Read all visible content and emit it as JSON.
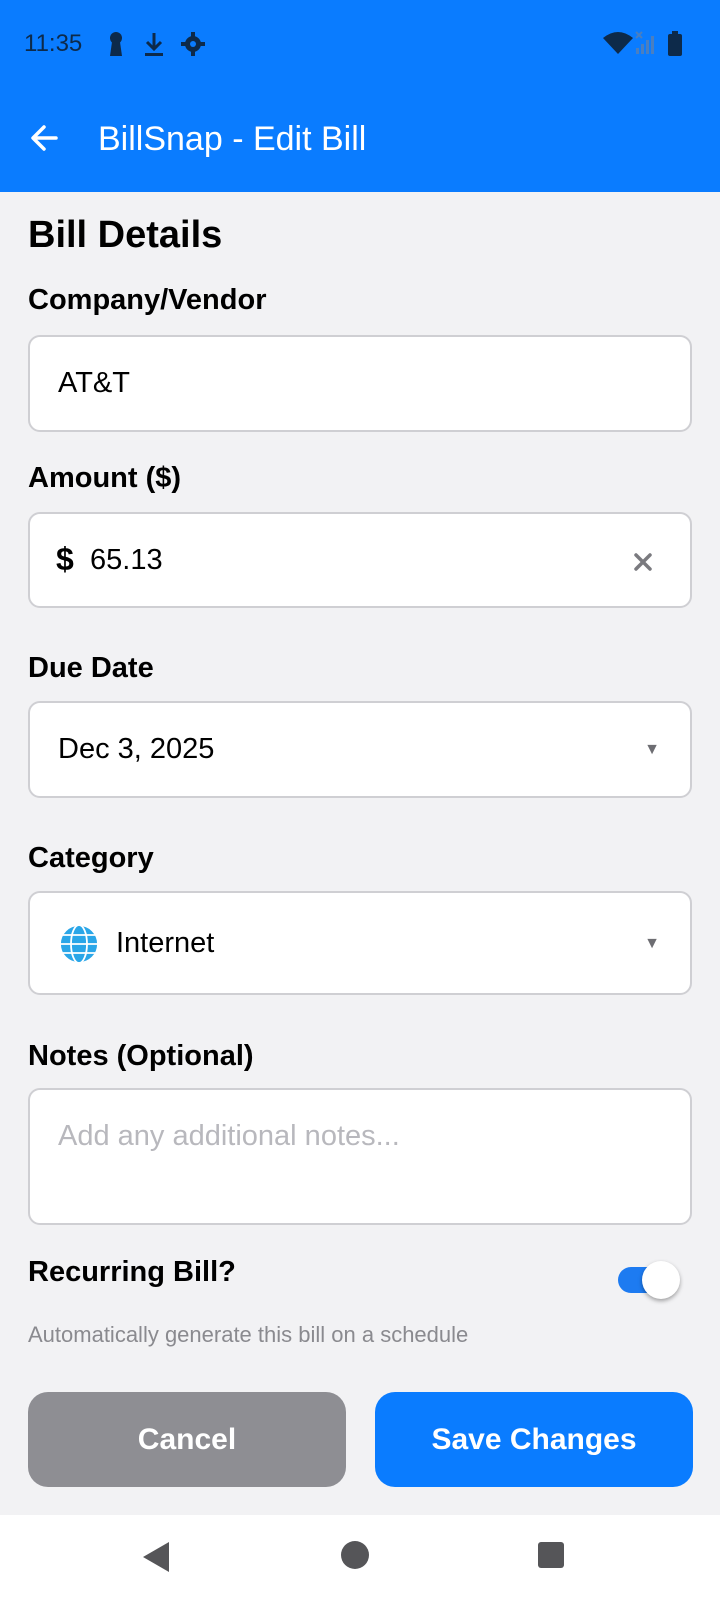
{
  "status_bar": {
    "time": "11:35",
    "icons": [
      "keyhole-icon",
      "download-icon",
      "settings-gear-icon",
      "wifi-icon",
      "signal-icon",
      "battery-icon"
    ]
  },
  "app_bar": {
    "title": "BillSnap - Edit Bill",
    "back_icon": "arrow-left-icon"
  },
  "form": {
    "section_title": "Bill Details",
    "company": {
      "label": "Company/Vendor",
      "value": "AT&T"
    },
    "amount": {
      "label": "Amount ($)",
      "currency_symbol": "$",
      "value": "65.13",
      "clear_icon": "close-x-icon"
    },
    "due_date": {
      "label": "Due Date",
      "value": "Dec 3, 2025",
      "caret_icon": "caret-down-icon"
    },
    "category": {
      "label": "Category",
      "icon": "globe-icon",
      "value": "Internet",
      "caret_icon": "caret-down-icon"
    },
    "notes": {
      "label": "Notes (Optional)",
      "placeholder": "Add any additional notes..."
    },
    "recurring": {
      "label": "Recurring Bill?",
      "enabled": true,
      "helper": "Automatically generate this bill on a schedule"
    }
  },
  "actions": {
    "cancel_label": "Cancel",
    "save_label": "Save Changes"
  },
  "nav_bar": {
    "icons": [
      "back-triangle-icon",
      "home-circle-icon",
      "recents-square-icon"
    ]
  },
  "colors": {
    "primary": "#0a7cff",
    "cancel_gray": "#8e8e93",
    "toggle_on": "#1d7bf1"
  }
}
